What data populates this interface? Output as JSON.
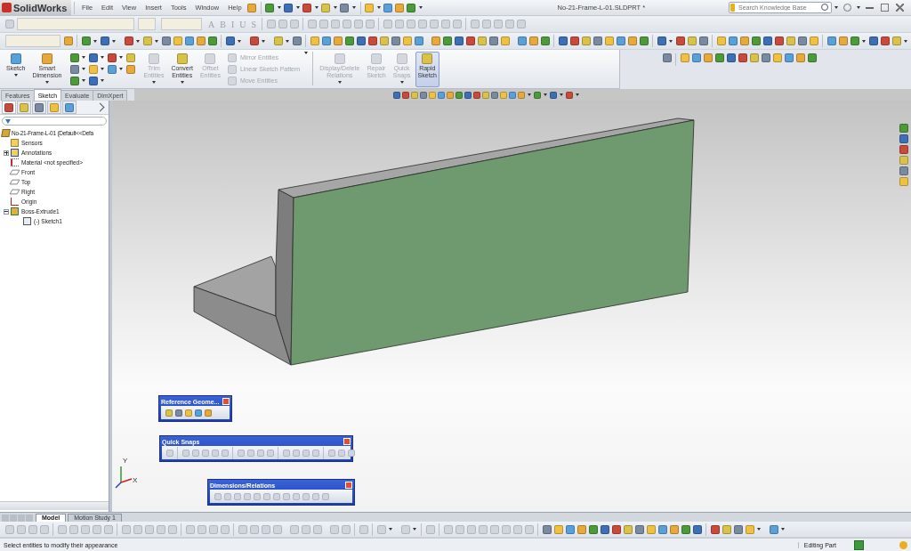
{
  "app": {
    "logo": "SolidWorks",
    "menu": [
      "File",
      "Edit",
      "View",
      "Insert",
      "Tools",
      "Window",
      "Help"
    ],
    "document_title": "No-21-Frame-L-01.SLDPRT *"
  },
  "search": {
    "placeholder": "Search Knowledge Base"
  },
  "format_toolbar": {
    "disabled": true,
    "buttons": [
      "A",
      "B",
      "I",
      "U",
      "S"
    ]
  },
  "command_manager": {
    "items": [
      {
        "kind": "large",
        "label": "Sketch",
        "disabled": false,
        "selected": false,
        "dropdown": true
      },
      {
        "kind": "large",
        "label": "Smart Dimension",
        "disabled": false,
        "selected": false,
        "dropdown": true
      },
      {
        "kind": "tools"
      },
      {
        "kind": "large",
        "label": "Trim Entities",
        "disabled": true,
        "selected": false,
        "dropdown": true
      },
      {
        "kind": "large",
        "label": "Convert Entities",
        "disabled": false,
        "selected": false,
        "dropdown": true
      },
      {
        "kind": "large",
        "label": "Offset Entities",
        "disabled": true,
        "selected": false,
        "dropdown": false
      },
      {
        "kind": "column",
        "items": [
          {
            "label": "Mirror Entities",
            "disabled": true
          },
          {
            "label": "Linear Sketch Pattern",
            "disabled": true
          },
          {
            "label": "Move Entities",
            "disabled": true
          }
        ]
      },
      {
        "kind": "large",
        "label": "Display/Delete Relations",
        "disabled": true,
        "selected": false,
        "dropdown": true
      },
      {
        "kind": "large",
        "label": "Repair Sketch",
        "disabled": true,
        "selected": false,
        "dropdown": false
      },
      {
        "kind": "large",
        "label": "Quick Snaps",
        "disabled": true,
        "selected": false,
        "dropdown": true
      },
      {
        "kind": "large",
        "label": "Rapid Sketch",
        "disabled": false,
        "selected": true,
        "dropdown": false
      }
    ]
  },
  "tabs": [
    {
      "label": "Features",
      "selected": false
    },
    {
      "label": "Sketch",
      "selected": true
    },
    {
      "label": "Evaluate",
      "selected": false
    },
    {
      "label": "DimXpert",
      "selected": false
    }
  ],
  "feature_tree": {
    "panel_tabs": [
      {
        "selected": true
      },
      {
        "selected": false
      },
      {
        "selected": false
      },
      {
        "selected": false
      },
      {
        "selected": false
      }
    ],
    "items": [
      {
        "kind": "part",
        "label": "No-21-Frame-L-01  (Default<<Defa",
        "children": [
          {
            "kind": "sensors",
            "label": "Sensors"
          },
          {
            "kind": "annotations",
            "label": "Annotations",
            "expanded": false
          },
          {
            "kind": "material",
            "label": "Material <not specified>"
          },
          {
            "kind": "plane",
            "label": "Front"
          },
          {
            "kind": "plane",
            "label": "Top"
          },
          {
            "kind": "plane",
            "label": "Right"
          },
          {
            "kind": "origin",
            "label": "Origin"
          },
          {
            "kind": "feature",
            "label": "Boss-Extrude1",
            "expanded": true,
            "children": [
              {
                "kind": "sketch",
                "label": "(-) Sketch1"
              }
            ]
          }
        ]
      }
    ]
  },
  "viewport": {
    "floating_toolbars": [
      {
        "kind": "reference",
        "title": "Reference Geome..."
      },
      {
        "kind": "snaps",
        "title": "Quick Snaps"
      },
      {
        "kind": "dimensions",
        "title": "Dimensions/Relations"
      }
    ],
    "triad": {
      "labels": [
        "Y",
        "X"
      ]
    }
  },
  "bottom_tabs": [
    {
      "label": "Model",
      "selected": true
    },
    {
      "label": "Motion Study 1",
      "selected": false
    }
  ],
  "status_bar": {
    "message": "Select entities to modify their appearance",
    "mode": "Editing Part"
  }
}
